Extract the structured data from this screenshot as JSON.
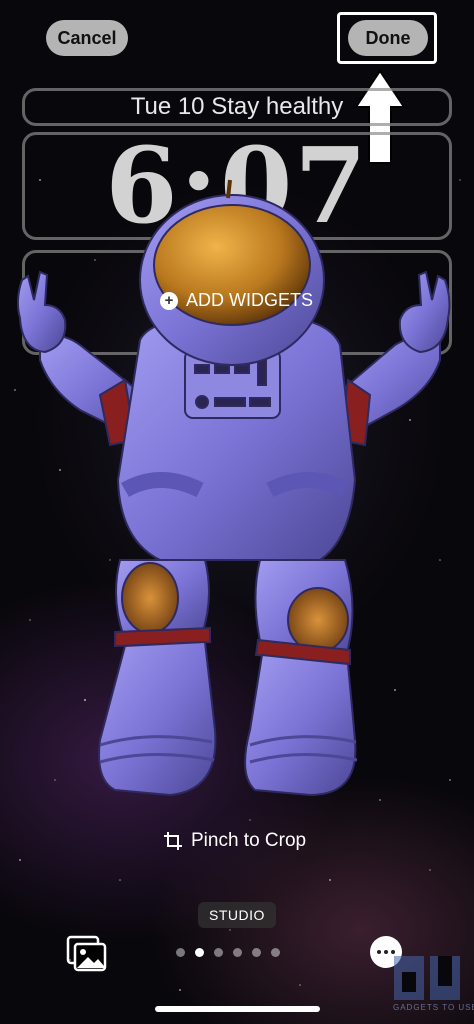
{
  "header": {
    "cancel_label": "Cancel",
    "done_label": "Done"
  },
  "lock_screen": {
    "date_widget_text": "Tue 10  Stay healthy",
    "time": "6:07",
    "add_widgets_label": "ADD WIDGETS"
  },
  "wallpaper": {
    "crop_hint": "Pinch to Crop",
    "style_label": "STUDIO",
    "subject": "astronaut"
  },
  "pager": {
    "count": 6,
    "active_index": 1
  },
  "icons": {
    "photos": "photos-icon",
    "more": "more-icon",
    "crop": "crop-icon",
    "up_arrow": "up-arrow-annotation"
  },
  "watermark": {
    "text": "GADGETS TO USE"
  },
  "colors": {
    "suit": "#7b74d6",
    "visor": "#b9781e",
    "stripe": "#8a1f1f",
    "button_bg": "#d2d2d2"
  }
}
